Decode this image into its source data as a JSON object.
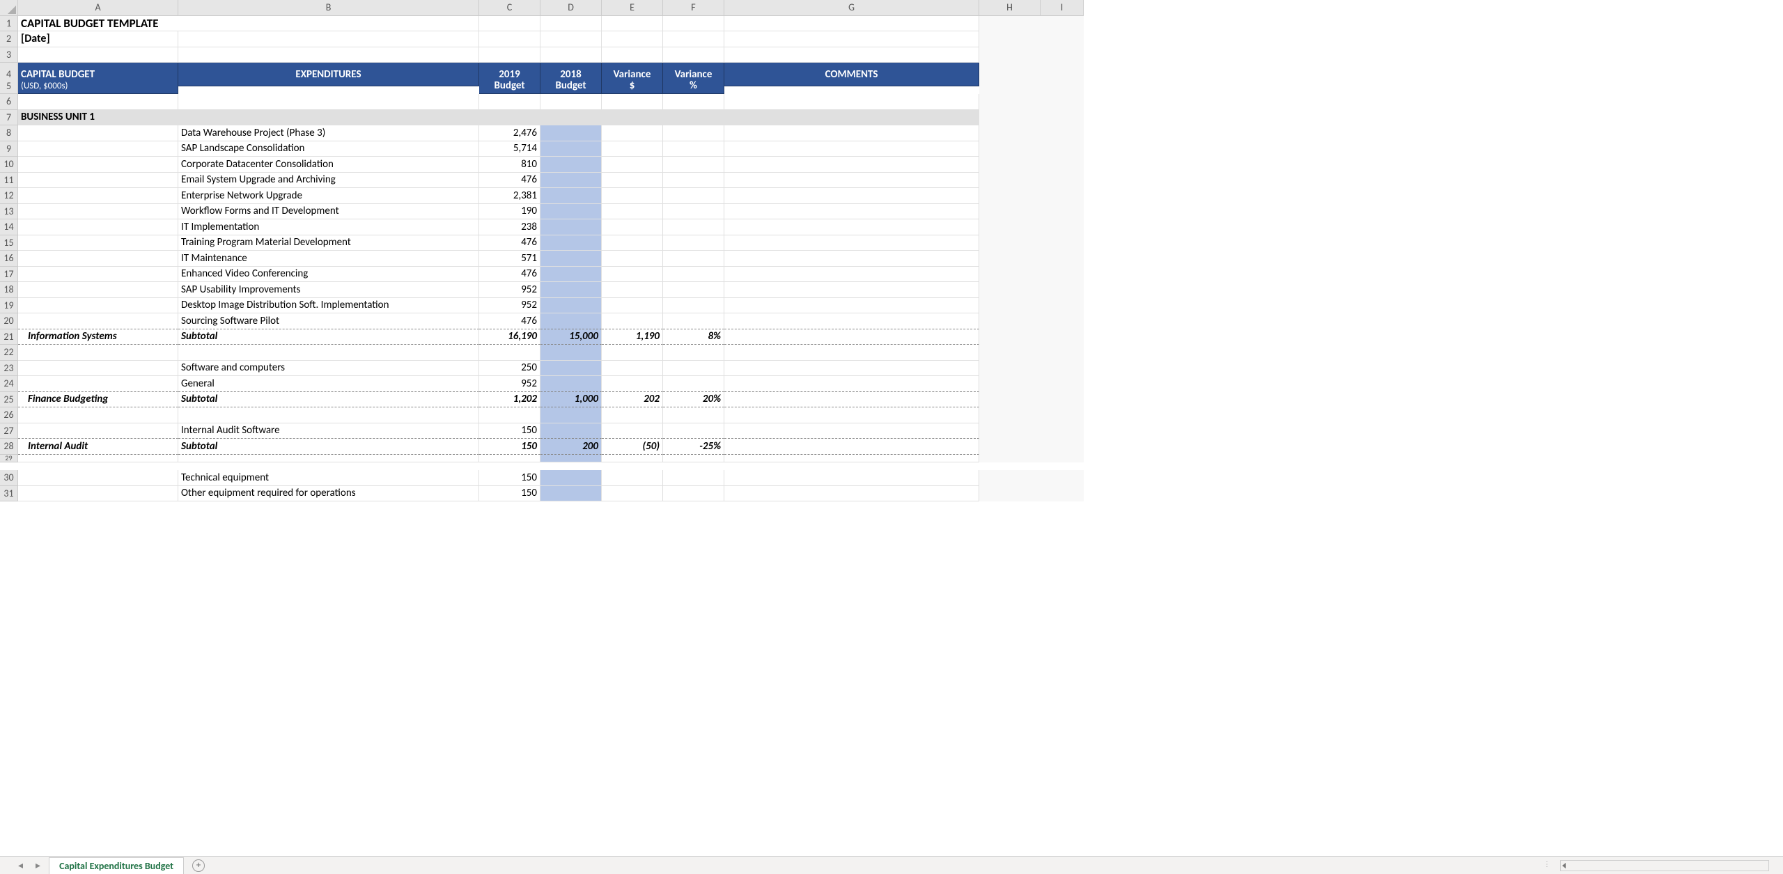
{
  "columns": [
    "A",
    "B",
    "C",
    "D",
    "E",
    "F",
    "G",
    "H",
    "I"
  ],
  "title": "CAPITAL BUDGET TEMPLATE",
  "date_placeholder": "[Date]",
  "header": {
    "capital_budget": "CAPITAL BUDGET",
    "expenditures": "EXPENDITURES",
    "year_current": "2019",
    "year_prior": "2018",
    "variance": "Variance",
    "comments": "COMMENTS",
    "units": "(USD, $000s)",
    "budget": "Budget",
    "dollar": "$",
    "percent": "%"
  },
  "bu1": "BUSINESS UNIT 1",
  "items": {
    "r8": {
      "b": "Data Warehouse Project (Phase 3)",
      "c": "2,476"
    },
    "r9": {
      "b": "SAP Landscape Consolidation",
      "c": "5,714"
    },
    "r10": {
      "b": "Corporate Datacenter Consolidation",
      "c": "810"
    },
    "r11": {
      "b": "Email System Upgrade and Archiving",
      "c": "476"
    },
    "r12": {
      "b": "Enterprise Network Upgrade",
      "c": "2,381"
    },
    "r13": {
      "b": "Workflow Forms and IT Development",
      "c": "190"
    },
    "r14": {
      "b": "IT Implementation",
      "c": "238"
    },
    "r15": {
      "b": "Training Program Material Development",
      "c": "476"
    },
    "r16": {
      "b": "IT Maintenance",
      "c": "571"
    },
    "r17": {
      "b": "Enhanced Video Conferencing",
      "c": "476"
    },
    "r18": {
      "b": "SAP Usability Improvements",
      "c": "952"
    },
    "r19": {
      "b": "Desktop Image Distribution Soft. Implementation",
      "c": "952"
    },
    "r20": {
      "b": "Sourcing Software Pilot",
      "c": "476"
    }
  },
  "sub21": {
    "a": "Information Systems",
    "b": "Subtotal",
    "c": "16,190",
    "d": "15,000",
    "e": "1,190",
    "f": "8%"
  },
  "items2": {
    "r23": {
      "b": "Software and computers",
      "c": "250"
    },
    "r24": {
      "b": "General",
      "c": "952"
    }
  },
  "sub25": {
    "a": "Finance Budgeting",
    "b": "Subtotal",
    "c": "1,202",
    "d": "1,000",
    "e": "202",
    "f": "20%"
  },
  "items3": {
    "r27": {
      "b": "Internal Audit Software",
      "c": "150"
    }
  },
  "sub28": {
    "a": "Internal Audit",
    "b": "Subtotal",
    "c": "150",
    "d": "200",
    "e": "(50)",
    "f": "-25%"
  },
  "items4": {
    "r30": {
      "b": "Technical equipment",
      "c": "150"
    },
    "r31": {
      "b": "Other equipment required for operations",
      "c": "150"
    }
  },
  "tab_name": "Capital Expenditures Budget"
}
